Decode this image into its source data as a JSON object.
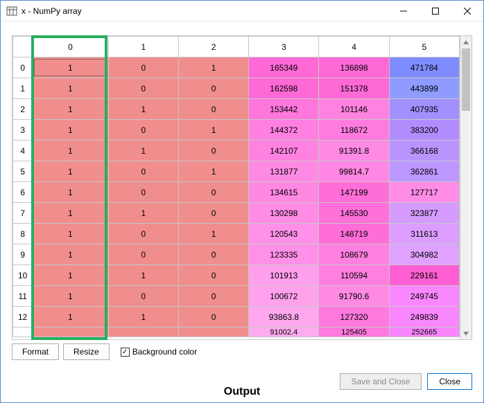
{
  "window": {
    "title": "x - NumPy array"
  },
  "columns": [
    "0",
    "1",
    "2",
    "3",
    "4",
    "5"
  ],
  "rows": [
    {
      "hdr": "0",
      "cells": [
        "1",
        "0",
        "1",
        "165349",
        "136898",
        "471784"
      ],
      "colors": [
        "#f08e8e",
        "#f08e8e",
        "#f08e8e",
        "#ff69d6",
        "#ff69d6",
        "#7f8cff"
      ]
    },
    {
      "hdr": "1",
      "cells": [
        "1",
        "0",
        "0",
        "162598",
        "151378",
        "443899"
      ],
      "colors": [
        "#f08e8e",
        "#f08e8e",
        "#f08e8e",
        "#ff69d6",
        "#ff69d6",
        "#8e9bff"
      ]
    },
    {
      "hdr": "2",
      "cells": [
        "1",
        "1",
        "0",
        "153442",
        "101146",
        "407935"
      ],
      "colors": [
        "#f08e8e",
        "#f08e8e",
        "#f08e8e",
        "#ff76dc",
        "#ff82e0",
        "#a390ff"
      ]
    },
    {
      "hdr": "3",
      "cells": [
        "1",
        "0",
        "1",
        "144372",
        "118672",
        "383200"
      ],
      "colors": [
        "#f08e8e",
        "#f08e8e",
        "#f08e8e",
        "#ff80e0",
        "#ff7bde",
        "#b18cff"
      ]
    },
    {
      "hdr": "4",
      "cells": [
        "1",
        "1",
        "0",
        "142107",
        "91391.8",
        "366168"
      ],
      "colors": [
        "#f08e8e",
        "#f08e8e",
        "#f08e8e",
        "#ff82e0",
        "#ff8ae4",
        "#b994ff"
      ]
    },
    {
      "hdr": "5",
      "cells": [
        "1",
        "0",
        "1",
        "131877",
        "99814.7",
        "362861"
      ],
      "colors": [
        "#f08e8e",
        "#f08e8e",
        "#f08e8e",
        "#ff8ae4",
        "#ff86e2",
        "#bd97ff"
      ]
    },
    {
      "hdr": "6",
      "cells": [
        "1",
        "0",
        "0",
        "134615",
        "147199",
        "127717"
      ],
      "colors": [
        "#f08e8e",
        "#f08e8e",
        "#f08e8e",
        "#ff88e3",
        "#ff6ed8",
        "#ff8de6"
      ]
    },
    {
      "hdr": "7",
      "cells": [
        "1",
        "1",
        "0",
        "130298",
        "145530",
        "323877"
      ],
      "colors": [
        "#f08e8e",
        "#f08e8e",
        "#f08e8e",
        "#ff8ce5",
        "#ff70d9",
        "#d59bff"
      ]
    },
    {
      "hdr": "8",
      "cells": [
        "1",
        "0",
        "1",
        "120543",
        "148719",
        "311613"
      ],
      "colors": [
        "#f08e8e",
        "#f08e8e",
        "#f08e8e",
        "#ff92e8",
        "#ff6dd8",
        "#db9eff"
      ]
    },
    {
      "hdr": "9",
      "cells": [
        "1",
        "0",
        "0",
        "123335",
        "108679",
        "304982"
      ],
      "colors": [
        "#f08e8e",
        "#f08e8e",
        "#f08e8e",
        "#ff90e7",
        "#ff80e0",
        "#dfa2ff"
      ]
    },
    {
      "hdr": "10",
      "cells": [
        "1",
        "1",
        "0",
        "101913",
        "110594",
        "229161"
      ],
      "colors": [
        "#f08e8e",
        "#f08e8e",
        "#f08e8e",
        "#ffa0ec",
        "#ff7fe0",
        "#ff5fd2"
      ]
    },
    {
      "hdr": "11",
      "cells": [
        "1",
        "0",
        "0",
        "100672",
        "91790.6",
        "249745"
      ],
      "colors": [
        "#f08e8e",
        "#f08e8e",
        "#f08e8e",
        "#ffa2ed",
        "#ff8ae4",
        "#f987ff"
      ]
    },
    {
      "hdr": "12",
      "cells": [
        "1",
        "1",
        "0",
        "93863.8",
        "127320",
        "249839"
      ],
      "colors": [
        "#f08e8e",
        "#f08e8e",
        "#f08e8e",
        "#ffa8ef",
        "#ff79de",
        "#f987ff"
      ]
    }
  ],
  "partial_row": {
    "hdr": "",
    "cells": [
      "",
      "",
      "",
      "91002.4",
      "125405",
      "252665"
    ],
    "colors": [
      "#f08e8e",
      "#f08e8e",
      "#f08e8e",
      "#ffabef",
      "#ff79de",
      "#f986ff"
    ]
  },
  "toolbar": {
    "format": "Format",
    "resize": "Resize",
    "bgcolor": "Background color"
  },
  "dialog": {
    "save_close": "Save and Close",
    "close": "Close"
  },
  "output_label": "Output",
  "chart_data": {
    "type": "table",
    "title": "x - NumPy array",
    "columns": [
      0,
      1,
      2,
      3,
      4,
      5
    ],
    "row_index": [
      0,
      1,
      2,
      3,
      4,
      5,
      6,
      7,
      8,
      9,
      10,
      11,
      12
    ],
    "data": [
      [
        1,
        0,
        1,
        165349,
        136898,
        471784
      ],
      [
        1,
        0,
        0,
        162598,
        151378,
        443899
      ],
      [
        1,
        1,
        0,
        153442,
        101146,
        407935
      ],
      [
        1,
        0,
        1,
        144372,
        118672,
        383200
      ],
      [
        1,
        1,
        0,
        142107,
        91391.8,
        366168
      ],
      [
        1,
        0,
        1,
        131877,
        99814.7,
        362861
      ],
      [
        1,
        0,
        0,
        134615,
        147199,
        127717
      ],
      [
        1,
        1,
        0,
        130298,
        145530,
        323877
      ],
      [
        1,
        0,
        1,
        120543,
        148719,
        311613
      ],
      [
        1,
        0,
        0,
        123335,
        108679,
        304982
      ],
      [
        1,
        1,
        0,
        101913,
        110594,
        229161
      ],
      [
        1,
        0,
        0,
        100672,
        91790.6,
        249745
      ],
      [
        1,
        1,
        0,
        93863.8,
        127320,
        249839
      ]
    ],
    "highlighted_column": 0
  }
}
